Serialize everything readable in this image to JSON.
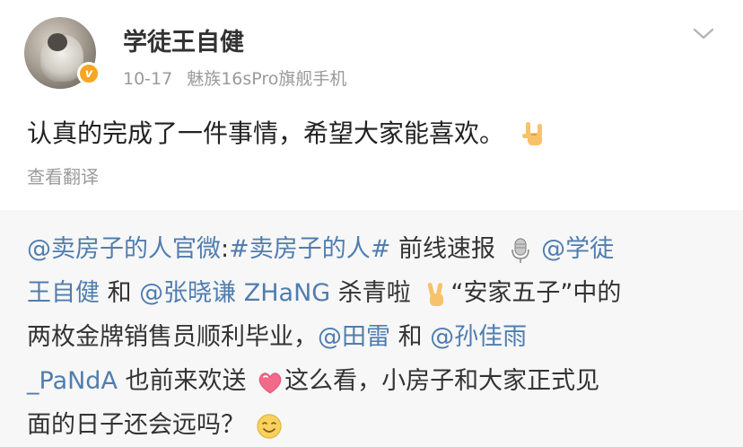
{
  "post": {
    "username": "学徒王自健",
    "date": "10-17",
    "device": "魅族16sPro旗舰手机",
    "badge_letter": "v",
    "text": "认真的完成了一件事情，希望大家能喜欢。",
    "text_emoji": "rock-hand-emoji",
    "translate_label": "查看翻译"
  },
  "repost": {
    "line1": {
      "mention_official": "@卖房子的人官微",
      "colon": ":",
      "hashtag": "#卖房子的人#",
      "plain1": " 前线速报",
      "mention_wang_part1": " @学徒"
    },
    "line2": {
      "mention_wang_part2": "王自健",
      "plain1": " 和 ",
      "mention_zhang": "@张晓谦 ZHaNG",
      "plain2": " 杀青啦",
      "plain3": "“安家五子”中的"
    },
    "line3": {
      "plain1": "两枚金牌销售员顺利毕业，",
      "mention_tian": "@田雷",
      "plain2": " 和 ",
      "mention_sun_part1": "@孙佳雨"
    },
    "line4": {
      "mention_sun_part2": "_PaNdA",
      "plain1": " 也前来欢送",
      "plain2": "这么看，小房子和大家正式见"
    },
    "line5": {
      "plain1": "面的日子还会远吗？"
    },
    "emojis": [
      "microphone-emoji",
      "victory-hand-emoji",
      "heart-emoji",
      "smile-emoji"
    ]
  },
  "colors": {
    "link": "#507daf",
    "text": "#333333",
    "meta": "#9a9a9a",
    "badge": "#f5a623",
    "repost_bg": "#f7f7f7"
  }
}
